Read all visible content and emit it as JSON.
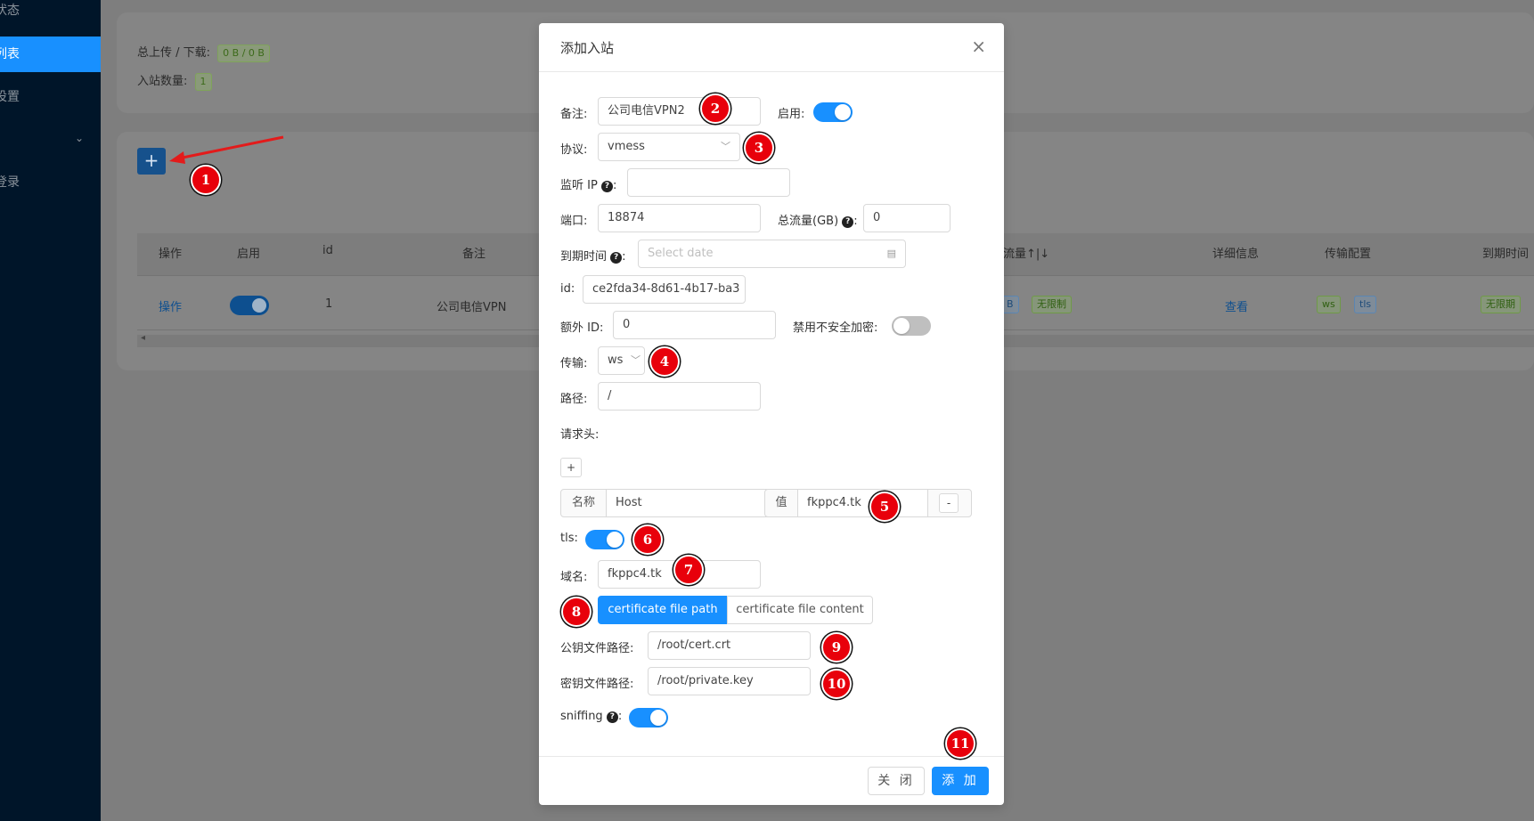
{
  "sidebar": {
    "items": [
      {
        "label": "状态"
      },
      {
        "label": "列表"
      },
      {
        "label": "设置"
      },
      {
        "label": "登录"
      }
    ]
  },
  "stats": {
    "traffic_label": "总上传 / 下载:",
    "traffic_value": "0 B / 0 B",
    "count_label": "入站数量:",
    "count_value": "1"
  },
  "add_button": {
    "label": "+"
  },
  "table": {
    "headers": [
      "操作",
      "启用",
      "id",
      "备注",
      "流量↑|↓",
      "详细信息",
      "传输配置",
      "到期时间"
    ],
    "row": {
      "action": "操作",
      "id": "1",
      "remark": "公司电信VPN",
      "traffic_tag": "B",
      "total_tag": "无限制",
      "detail": "查看",
      "transport_tags": [
        "ws",
        "tls"
      ],
      "expiry": "无限期"
    }
  },
  "modal": {
    "title": "添加入站",
    "close_symbol": "×",
    "fields": {
      "remark": {
        "label": "备注:",
        "value": "公司电信VPN2"
      },
      "enable": {
        "label": "启用:",
        "on": true
      },
      "protocol": {
        "label": "协议:",
        "value": "vmess"
      },
      "listen_ip": {
        "label": "监听 IP",
        "value": ""
      },
      "port": {
        "label": "端口:",
        "value": "18874"
      },
      "total": {
        "label": "总流量(GB)",
        "value": "0"
      },
      "expiry": {
        "label": "到期时间",
        "placeholder": "Select date"
      },
      "id": {
        "label": "id:",
        "value": "ce2fda34-8d61-4b17-ba3"
      },
      "alter_id": {
        "label": "额外 ID:",
        "value": "0"
      },
      "disable_insecure": {
        "label": "禁用不安全加密:",
        "on": false
      },
      "transport": {
        "label": "传输:",
        "value": "ws"
      },
      "path": {
        "label": "路径:",
        "value": "/"
      },
      "headers": {
        "label": "请求头:",
        "add": "+",
        "name_addon": "名称",
        "name_value": "Host",
        "value_addon": "值",
        "value_value": "fkppc4.tk",
        "remove": "-"
      },
      "tls": {
        "label": "tls:",
        "on": true
      },
      "domain": {
        "label": "域名:",
        "value": "fkppc4.tk"
      },
      "cert_mode": {
        "options": [
          "certificate file path",
          "certificate file content"
        ],
        "selected": 0
      },
      "pub_key_path": {
        "label": "公钥文件路径:",
        "value": "/root/cert.crt"
      },
      "priv_key_path": {
        "label": "密钥文件路径:",
        "value": "/root/private.key"
      },
      "sniffing": {
        "label": "sniffing",
        "on": true
      }
    },
    "footer": {
      "cancel": "关 闭",
      "submit": "添 加"
    }
  },
  "annotations": [
    "1",
    "2",
    "3",
    "4",
    "5",
    "6",
    "7",
    "8",
    "9",
    "10",
    "11"
  ],
  "colors": {
    "primary": "#1890ff",
    "sidebar": "#001529",
    "badge": "#e8000b"
  }
}
